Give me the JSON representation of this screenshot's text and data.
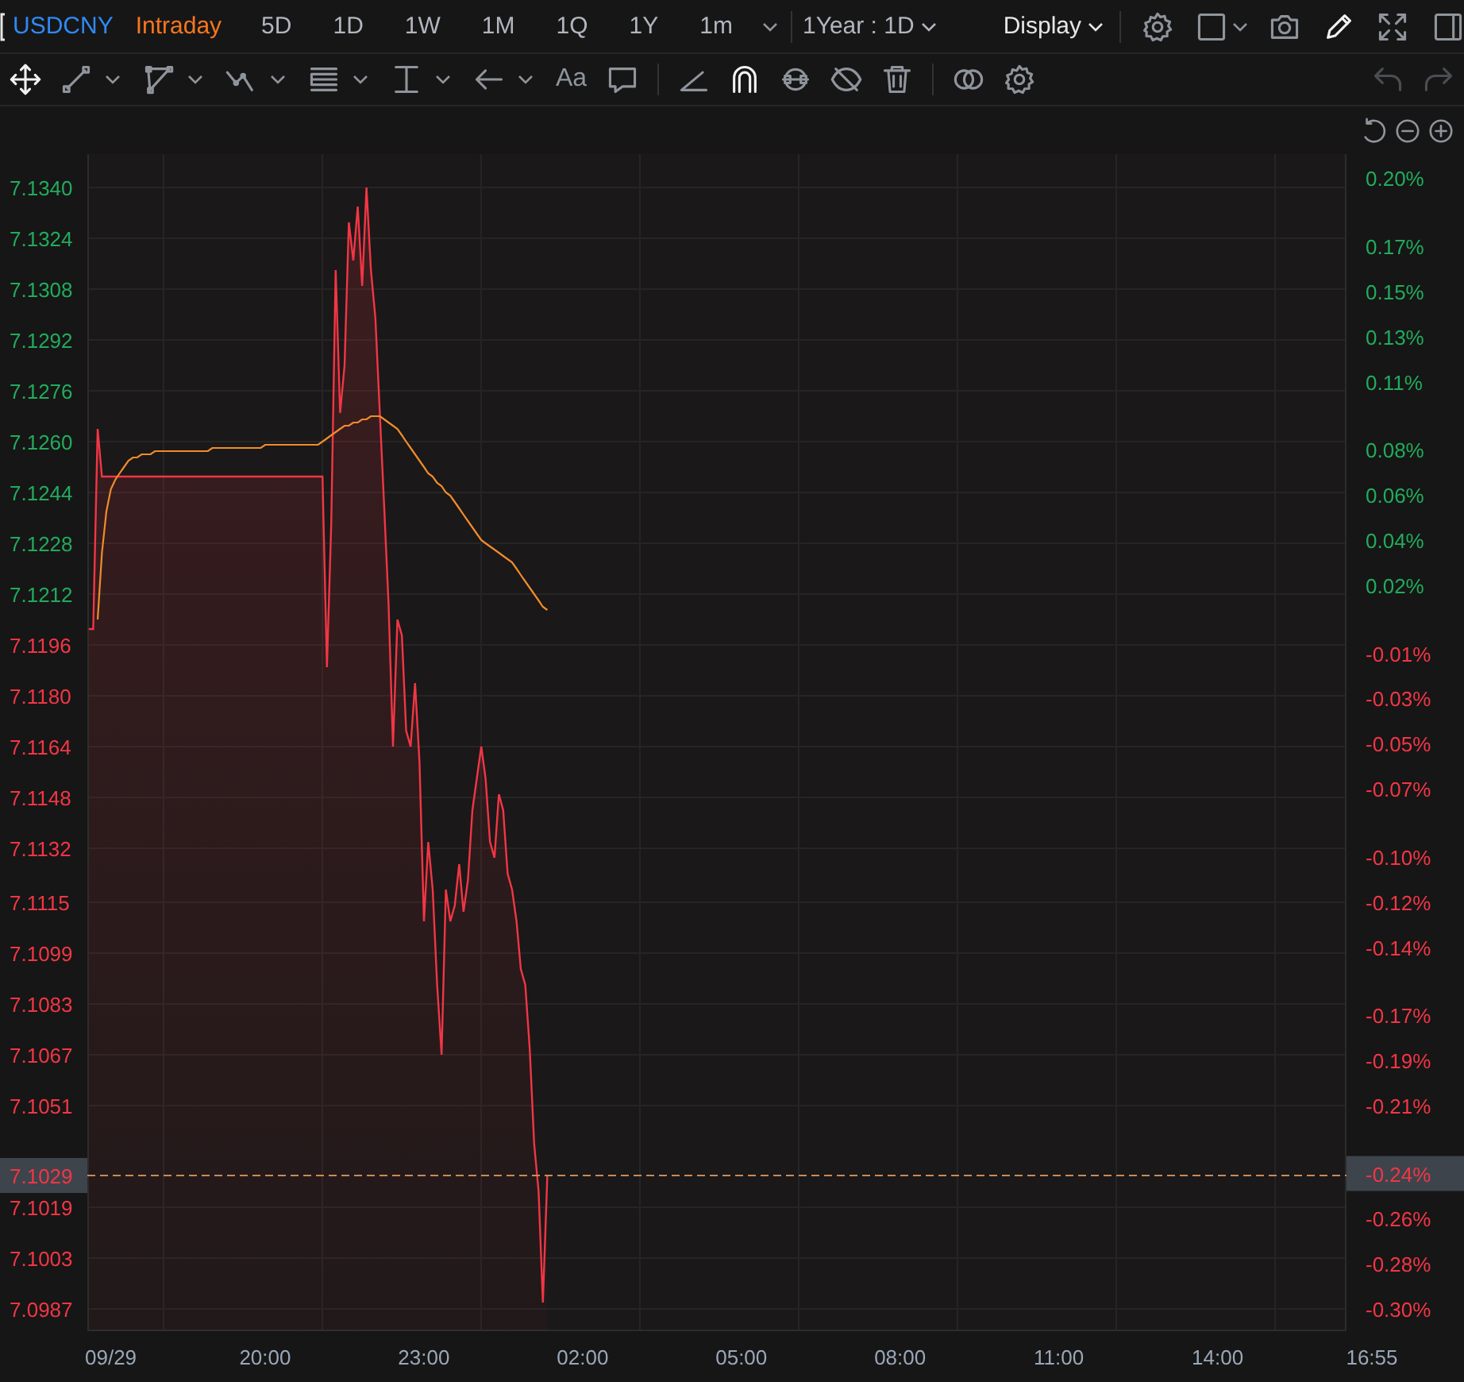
{
  "toolbar": {
    "symbol": "USDCNY",
    "periods": [
      {
        "label": "Intraday",
        "selected": true
      },
      {
        "label": "5D",
        "selected": false
      },
      {
        "label": "1D",
        "selected": false
      },
      {
        "label": "1W",
        "selected": false
      },
      {
        "label": "1M",
        "selected": false
      },
      {
        "label": "1Q",
        "selected": false
      },
      {
        "label": "1Y",
        "selected": false
      },
      {
        "label": "1m",
        "selected": false
      }
    ],
    "range": "1Year : 1D",
    "display": "Display",
    "tools": [
      {
        "kind": "settings",
        "active": false
      },
      {
        "kind": "square",
        "active": false,
        "menu": true
      },
      {
        "kind": "camera",
        "active": false
      },
      {
        "kind": "pencil",
        "active": true
      },
      {
        "kind": "fullscreen",
        "active": false
      },
      {
        "kind": "panel",
        "active": false
      }
    ]
  },
  "drawing_tools": [
    {
      "kind": "move",
      "active": true
    },
    {
      "kind": "segment",
      "active": false,
      "menu": true
    },
    {
      "kind": "polyline",
      "active": false,
      "menu": true
    },
    {
      "kind": "wave",
      "active": false,
      "menu": true
    },
    {
      "kind": "lines",
      "active": false,
      "menu": true
    },
    {
      "kind": "measure",
      "active": false,
      "menu": true
    },
    {
      "kind": "arrow",
      "active": false,
      "menu": true
    },
    {
      "kind": "text",
      "label": "Aa",
      "active": false
    },
    {
      "kind": "comment",
      "active": false
    },
    {
      "kind": "sep"
    },
    {
      "kind": "angle",
      "active": false
    },
    {
      "kind": "magnet",
      "active": true
    },
    {
      "kind": "loop",
      "active": false
    },
    {
      "kind": "hide",
      "active": false
    },
    {
      "kind": "trash",
      "active": false
    },
    {
      "kind": "sep"
    },
    {
      "kind": "circles",
      "active": false
    },
    {
      "kind": "settings",
      "active": false
    }
  ],
  "history": [
    {
      "kind": "undo",
      "disabled": true
    },
    {
      "kind": "redo",
      "disabled": true
    }
  ],
  "zoom_controls": [
    {
      "kind": "reset"
    },
    {
      "kind": "zoom-out"
    },
    {
      "kind": "zoom-in"
    }
  ],
  "chart": {
    "chart_data": {
      "type": "line",
      "grid": true,
      "ylim": [
        7.098,
        7.13505
      ],
      "y2lim": [
        -0.3097,
        0.2107
      ],
      "categories": [
        null,
        null,
        null,
        null,
        null,
        "09/29",
        null,
        null,
        null,
        null,
        null,
        null,
        null,
        null,
        null,
        null,
        null,
        null,
        null,
        null,
        null,
        null,
        null,
        null,
        null,
        null,
        null,
        null,
        null,
        null,
        null,
        null,
        null,
        null,
        null,
        null,
        null,
        null,
        null,
        null,
        "20:00",
        null,
        null,
        null,
        null,
        null,
        null,
        null,
        null,
        null,
        null,
        null,
        null,
        null,
        null,
        null,
        null,
        null,
        null,
        null,
        null,
        null,
        null,
        null,
        null,
        null,
        null,
        null,
        null,
        null,
        null,
        null,
        null,
        null,
        null,
        null,
        "23:00",
        null,
        null,
        null,
        null,
        null,
        null,
        null,
        null,
        null,
        null,
        null,
        null,
        null,
        null,
        null,
        null,
        null,
        null,
        null,
        null,
        null,
        null,
        null,
        null,
        null,
        null,
        null,
        null,
        null,
        null,
        null,
        null,
        null,
        null,
        null,
        "02:00",
        null,
        null,
        null,
        null,
        null,
        null,
        null,
        null,
        null,
        null,
        null,
        null,
        null,
        null,
        null,
        null,
        null,
        null,
        null,
        null,
        null,
        null,
        null,
        null,
        null,
        null,
        null,
        null,
        null,
        null,
        null,
        null,
        null,
        null,
        null,
        "05:00",
        null,
        null,
        null,
        null,
        null,
        null,
        null,
        null,
        null,
        null,
        null,
        null,
        null,
        null,
        null,
        null,
        null,
        null,
        null,
        null,
        null,
        null,
        null,
        null,
        null,
        null,
        null,
        null,
        null,
        null,
        null,
        null,
        null,
        null,
        null,
        "08:00",
        null,
        null,
        null,
        null,
        null,
        null,
        null,
        null,
        null,
        null,
        null,
        null,
        null,
        null,
        null,
        null,
        null,
        null,
        null,
        null,
        null,
        null,
        null,
        null,
        null,
        null,
        null,
        null,
        null,
        null,
        null,
        null,
        null,
        null,
        null,
        "11:00",
        null,
        null,
        null,
        null,
        null,
        null,
        null,
        null,
        null,
        null,
        null,
        null,
        null,
        null,
        null,
        null,
        null,
        null,
        null,
        null,
        null,
        null,
        null,
        null,
        null,
        null,
        null,
        null,
        null,
        null,
        null,
        null,
        null,
        null,
        null,
        "14:00",
        null,
        null,
        null,
        null,
        null,
        null,
        null,
        null,
        null,
        null,
        null,
        null,
        null,
        null,
        null,
        null,
        null,
        null,
        null,
        null,
        null,
        null,
        null,
        null,
        null,
        null,
        null,
        null,
        null,
        null,
        null,
        null,
        null,
        null,
        "16:55"
      ],
      "yticks": [
        {
          "value": 7.134,
          "label": "7.1340"
        },
        7.1324,
        7.1308,
        7.1292,
        7.1276,
        {
          "value": 7.126,
          "label": "7.1260"
        },
        7.1244,
        7.1228,
        7.1212,
        7.1196,
        {
          "value": 7.118,
          "label": "7.1180"
        },
        7.1164,
        7.1148,
        7.1132,
        7.1115,
        7.1099,
        7.1083,
        7.1067,
        7.1051,
        7.1019,
        7.1003,
        7.0987
      ],
      "y2ticks": [
        {
          "value": 0.2,
          "label": "0.20%"
        },
        {
          "value": 0.17,
          "label": "0.17%"
        },
        {
          "value": 0.15,
          "label": "0.15%"
        },
        {
          "value": 0.13,
          "label": "0.13%"
        },
        {
          "value": 0.11,
          "label": "0.11%"
        },
        {
          "value": 0.08,
          "label": "0.08%"
        },
        {
          "value": 0.06,
          "label": "0.06%"
        },
        {
          "value": 0.04,
          "label": "0.04%"
        },
        {
          "value": 0.02,
          "label": "0.02%"
        },
        {
          "value": -0.01,
          "label": "-0.01%"
        },
        {
          "value": -0.03,
          "label": "-0.03%"
        },
        {
          "value": -0.05,
          "label": "-0.05%"
        },
        {
          "value": -0.07,
          "label": "-0.07%"
        },
        {
          "value": -0.1,
          "label": "-0.10%"
        },
        {
          "value": -0.12,
          "label": "-0.12%"
        },
        {
          "value": -0.14,
          "label": "-0.14%"
        },
        {
          "value": -0.17,
          "label": "-0.17%"
        },
        {
          "value": -0.19,
          "label": "-0.19%"
        },
        {
          "value": -0.21,
          "label": "-0.21%"
        },
        {
          "value": -0.24,
          "label": "-0.24%"
        },
        {
          "value": -0.26,
          "label": "-0.26%"
        },
        {
          "value": -0.28,
          "label": "-0.28%"
        },
        {
          "value": -0.3,
          "label": "-0.30%"
        }
      ],
      "series": [
        {
          "color": "#f23645",
          "values": [
            7.1201,
            7.1201,
            7.1264,
            7.1249,
            7.1249,
            7.1249,
            7.1249,
            7.1249,
            7.1249,
            7.1249,
            7.1249,
            7.1249,
            7.1249,
            7.1249,
            7.1249,
            7.1249,
            7.1249,
            7.1249,
            7.1249,
            7.1249,
            7.1249,
            7.1249,
            7.1249,
            7.1249,
            7.1249,
            7.1249,
            7.1249,
            7.1249,
            7.1249,
            7.1249,
            7.1249,
            7.1249,
            7.1249,
            7.1249,
            7.1249,
            7.1249,
            7.1249,
            7.1249,
            7.1249,
            7.1249,
            7.1249,
            7.1249,
            7.1249,
            7.1249,
            7.1249,
            7.1249,
            7.1249,
            7.1249,
            7.1249,
            7.1249,
            7.1249,
            7.1249,
            7.1249,
            7.1249,
            7.1189,
            7.1234,
            7.1314,
            7.1269,
            7.1284,
            7.1329,
            7.1317,
            7.1334,
            7.1309,
            7.134,
            7.1314,
            7.1299,
            7.1269,
            7.1239,
            7.1209,
            7.1164,
            7.1204,
            7.1199,
            7.1169,
            7.1164,
            7.1184,
            7.1159,
            7.1109,
            7.1134,
            7.1119,
            7.1089,
            7.1067,
            7.1119,
            7.1109,
            7.1114,
            7.1127,
            7.1112,
            7.1122,
            7.1144,
            7.1154,
            7.1164,
            7.1154,
            7.1134,
            7.1129,
            7.1149,
            7.1144,
            7.1124,
            7.1119,
            7.1109,
            7.1094,
            7.1089,
            7.1069,
            7.1039,
            7.1024,
            7.0989,
            7.1029,
            null,
            null,
            null,
            null,
            null,
            null,
            null,
            null,
            null,
            null,
            null,
            null,
            null,
            null,
            null,
            null,
            null,
            null,
            null,
            null,
            null,
            null,
            null,
            null,
            null,
            null,
            null,
            null,
            null,
            null,
            null,
            null,
            null,
            null,
            null,
            null,
            null,
            null,
            null,
            null,
            null,
            null,
            null,
            null,
            null,
            null,
            null,
            null,
            null,
            null,
            null,
            null,
            null,
            null,
            null,
            null,
            null,
            null,
            null,
            null,
            null,
            null,
            null,
            null,
            null,
            null,
            null,
            null,
            null,
            null,
            null,
            null,
            null,
            null,
            null,
            null,
            null,
            null,
            null,
            null,
            null,
            null,
            null,
            null,
            null,
            null,
            null,
            null,
            null,
            null,
            null,
            null,
            null,
            null,
            null,
            null,
            null,
            null,
            null,
            null,
            null,
            null,
            null,
            null,
            null,
            null,
            null,
            null,
            null,
            null,
            null,
            null,
            null,
            null,
            null,
            null,
            null,
            null,
            null,
            null,
            null,
            null,
            null,
            null,
            null,
            null,
            null,
            null,
            null,
            null,
            null,
            null,
            null,
            null,
            null,
            null,
            null,
            null,
            null,
            null,
            null,
            null,
            null,
            null,
            null,
            null,
            null,
            null,
            null,
            null,
            null,
            null,
            null,
            null,
            null,
            null,
            null,
            null,
            null,
            null,
            null,
            null,
            null,
            null,
            null,
            null,
            null,
            null,
            null,
            null,
            null,
            null,
            null,
            null,
            null,
            null,
            null,
            null,
            null,
            null,
            null,
            null,
            null,
            null,
            null,
            null,
            null
          ]
        },
        {
          "color": "#f08c2c",
          "values": [
            null,
            null,
            7.1204,
            7.1225,
            7.1238,
            7.1245,
            7.1248,
            7.125,
            7.1252,
            7.1254,
            7.1255,
            7.1255,
            7.1256,
            7.1256,
            7.1256,
            7.1257,
            7.1257,
            7.1257,
            7.1257,
            7.1257,
            7.1257,
            7.1257,
            7.1257,
            7.1257,
            7.1257,
            7.1257,
            7.1257,
            7.1257,
            7.1258,
            7.1258,
            7.1258,
            7.1258,
            7.1258,
            7.1258,
            7.1258,
            7.1258,
            7.1258,
            7.1258,
            7.1258,
            7.1258,
            7.1259,
            7.1259,
            7.1259,
            7.1259,
            7.1259,
            7.1259,
            7.1259,
            7.1259,
            7.1259,
            7.1259,
            7.1259,
            7.1259,
            7.1259,
            7.126,
            7.1261,
            7.1262,
            7.1263,
            7.1264,
            7.1265,
            7.1265,
            7.1266,
            7.1266,
            7.1267,
            7.1267,
            7.1268,
            7.1268,
            7.1268,
            7.1267,
            7.1266,
            7.1265,
            7.1264,
            7.1262,
            7.126,
            7.1258,
            7.1256,
            7.1254,
            7.1252,
            7.125,
            7.1249,
            7.1247,
            7.1246,
            7.1244,
            7.1243,
            7.1241,
            7.1239,
            7.1237,
            7.1235,
            7.1233,
            7.1231,
            7.1229,
            7.1228,
            7.1227,
            7.1226,
            7.1225,
            7.1224,
            7.1223,
            7.1222,
            7.122,
            7.1218,
            7.1216,
            7.1214,
            7.1212,
            7.121,
            7.1208,
            7.1207,
            null,
            null,
            null,
            null,
            null,
            null,
            null,
            null,
            null,
            null,
            null,
            null,
            null,
            null,
            null,
            null,
            null,
            null,
            null,
            null,
            null,
            null,
            null,
            null,
            null,
            null,
            null,
            null,
            null,
            null,
            null,
            null,
            null,
            null,
            null,
            null,
            null,
            null,
            null,
            null,
            null,
            null,
            null,
            null,
            null,
            null,
            null,
            null,
            null,
            null,
            null,
            null,
            null,
            null,
            null,
            null,
            null,
            null,
            null,
            null,
            null,
            null,
            null,
            null,
            null,
            null,
            null,
            null,
            null,
            null,
            null,
            null,
            null,
            null,
            null,
            null,
            null,
            null,
            null,
            null,
            null,
            null,
            null,
            null,
            null,
            null,
            null,
            null,
            null,
            null,
            null,
            null,
            null,
            null,
            null,
            null,
            null,
            null,
            null,
            null,
            null,
            null,
            null,
            null,
            null,
            null,
            null,
            null,
            null,
            null,
            null,
            null,
            null,
            null,
            null,
            null,
            null,
            null,
            null,
            null,
            null,
            null,
            null,
            null,
            null,
            null,
            null,
            null,
            null,
            null,
            null,
            null,
            null,
            null,
            null,
            null,
            null,
            null,
            null,
            null,
            null,
            null,
            null,
            null,
            null,
            null,
            null,
            null,
            null,
            null,
            null,
            null,
            null,
            null,
            null,
            null,
            null,
            null,
            null,
            null,
            null,
            null,
            null,
            null,
            null,
            null,
            null,
            null,
            null,
            null,
            null,
            null,
            null,
            null,
            null,
            null,
            null,
            null,
            null,
            null,
            null,
            null,
            null,
            null,
            null,
            null,
            null
          ]
        }
      ],
      "ref_lines": [
        {
          "axis": "y",
          "value": 7.1029,
          "label": "7.1029"
        }
      ]
    }
  }
}
